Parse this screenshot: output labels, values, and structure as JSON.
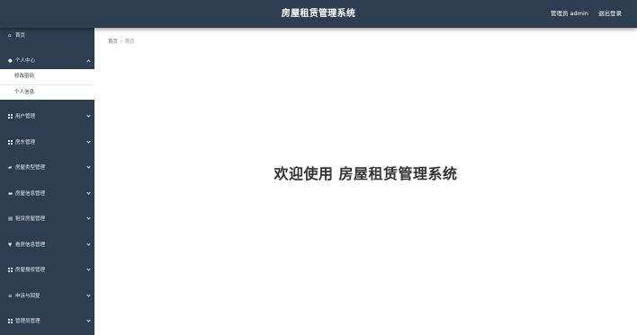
{
  "header": {
    "title": "房屋租赁管理系统",
    "user_label": "管理员 admin",
    "logout_label": "退出登录"
  },
  "sidebar": {
    "items": [
      {
        "label": "首页",
        "icon": "home-icon",
        "expanded": false
      },
      {
        "label": "个人中心",
        "icon": "user-icon",
        "expanded": true,
        "children": [
          {
            "label": "修改密码"
          },
          {
            "label": "个人信息"
          }
        ]
      },
      {
        "label": "用户管理",
        "icon": "grid-icon",
        "expanded": false
      },
      {
        "label": "房东管理",
        "icon": "grid-icon",
        "expanded": false
      },
      {
        "label": "房屋类型管理",
        "icon": "speech-bubble-icon",
        "expanded": false
      },
      {
        "label": "房屋信息管理",
        "icon": "briefcase-icon",
        "expanded": false
      },
      {
        "label": "租赁房屋管理",
        "icon": "list-icon",
        "expanded": false
      },
      {
        "label": "看房信息管理",
        "icon": "pin-icon",
        "expanded": false
      },
      {
        "label": "房屋报修管理",
        "icon": "grid-icon",
        "expanded": false
      },
      {
        "label": "申诉与回复",
        "icon": "menu-icon",
        "expanded": false
      },
      {
        "label": "管理员管理",
        "icon": "grid-icon",
        "expanded": false
      }
    ]
  },
  "breadcrumb": {
    "root": "首页",
    "separator": "/",
    "current": "首页"
  },
  "main": {
    "welcome": "欢迎使用 房屋租赁管理系统"
  },
  "colors": {
    "nav_bg": "#2e3e50",
    "nav_text": "#ffffff",
    "content_bg": "#ffffff",
    "welcome_text": "#333333"
  }
}
